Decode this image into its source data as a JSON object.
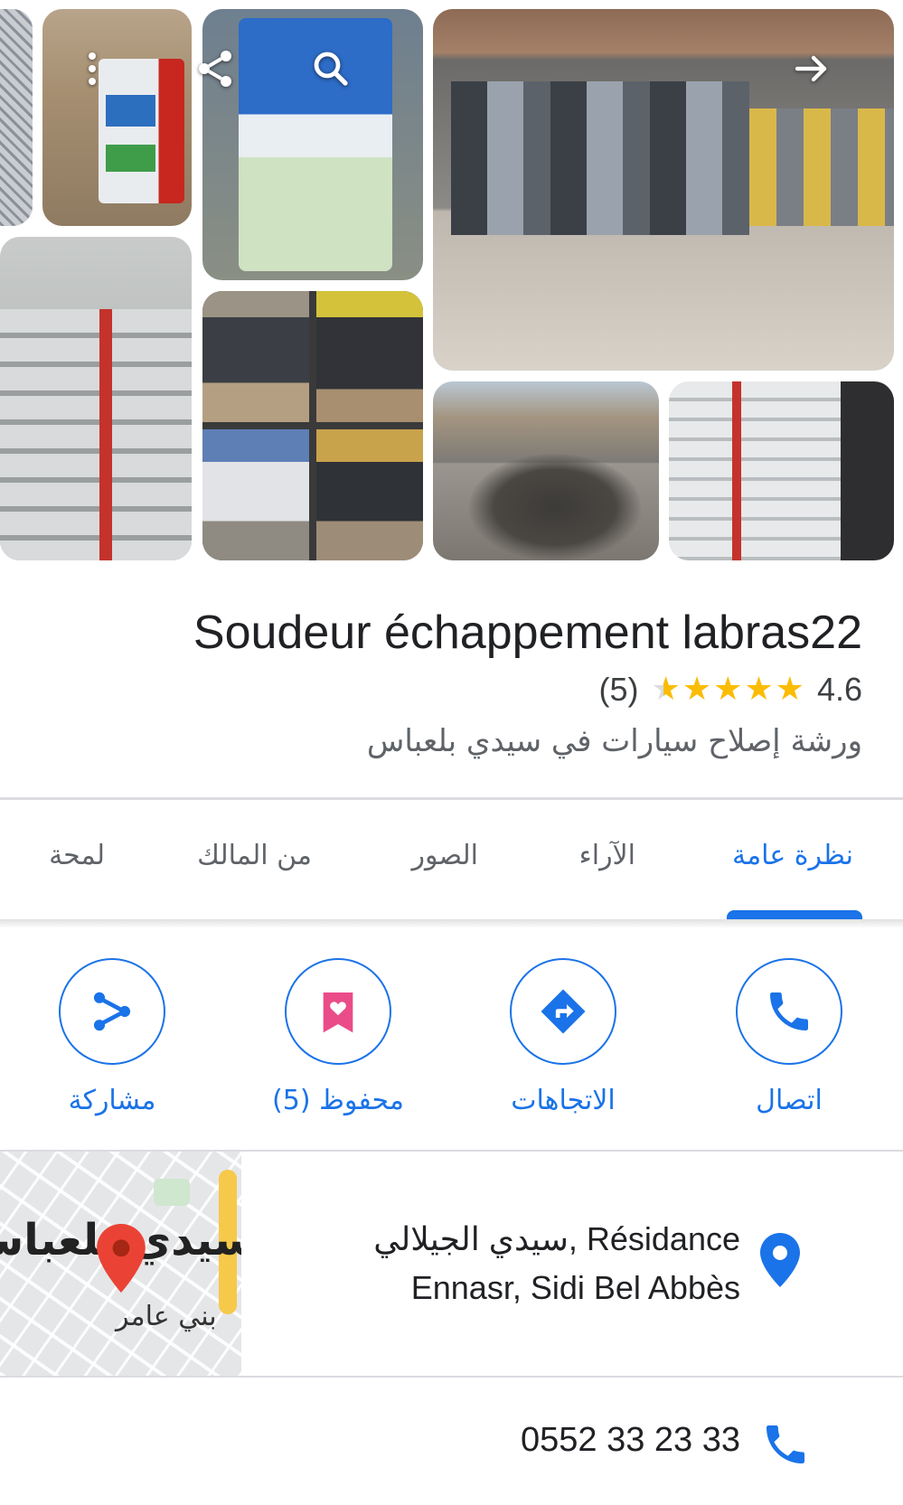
{
  "gallery": {
    "photo_count": 8
  },
  "place": {
    "name": "Soudeur échappement labras22",
    "rating": "4.6",
    "rating_stars_value": 4.6,
    "review_count": "(5)",
    "category": "ورشة إصلاح سيارات في سيدي بلعباس"
  },
  "tabs": [
    {
      "label": "نظرة عامة",
      "active": true
    },
    {
      "label": "الآراء",
      "active": false
    },
    {
      "label": "الصور",
      "active": false
    },
    {
      "label": "من المالك",
      "active": false
    },
    {
      "label": "لمحة",
      "active": false
    }
  ],
  "actions": {
    "call": "اتصال",
    "directions": "الاتجاهات",
    "saved": "محفوظ (5)",
    "share": "مشاركة"
  },
  "address": {
    "line1": "سيدي الجيلالي, Résidance",
    "line2": "Ennasr, Sidi Bel Abbès",
    "map_city_label": "سيدي بلعباس",
    "map_district_label": "بني عامر"
  },
  "phone": {
    "number": "0552 33 23 33"
  },
  "colors": {
    "accent": "#1a73e8",
    "star": "#fbbc04",
    "save_icon": "#ea4c89",
    "map_pin": "#ea4335"
  }
}
